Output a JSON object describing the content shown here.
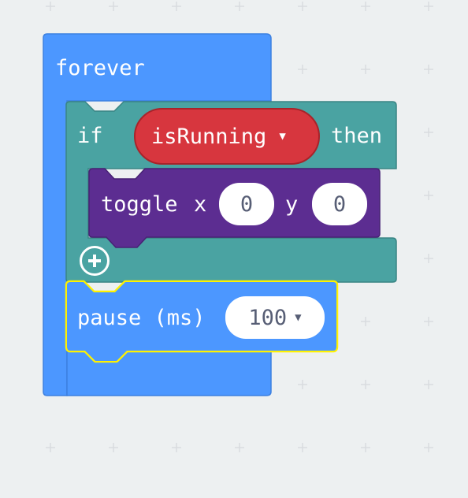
{
  "workspace": {
    "background": "#edf0f1",
    "grid_mark_color": "#d9dcdf"
  },
  "blocks": {
    "forever": {
      "label": "forever",
      "color": "#4c97ff"
    },
    "if_block": {
      "if_label": "if",
      "then_label": "then",
      "color": "#4aa3a2",
      "condition_variable": "isRunning",
      "condition_color": "#d7363e",
      "add_icon": "plus-circle-icon"
    },
    "toggle": {
      "label": "toggle",
      "x_label": "x",
      "x_value": "0",
      "y_label": "y",
      "y_value": "0",
      "color": "#5c2d91"
    },
    "pause": {
      "label": "pause (ms)",
      "value": "100",
      "color": "#4c97ff",
      "selection_color": "#fff200"
    }
  }
}
